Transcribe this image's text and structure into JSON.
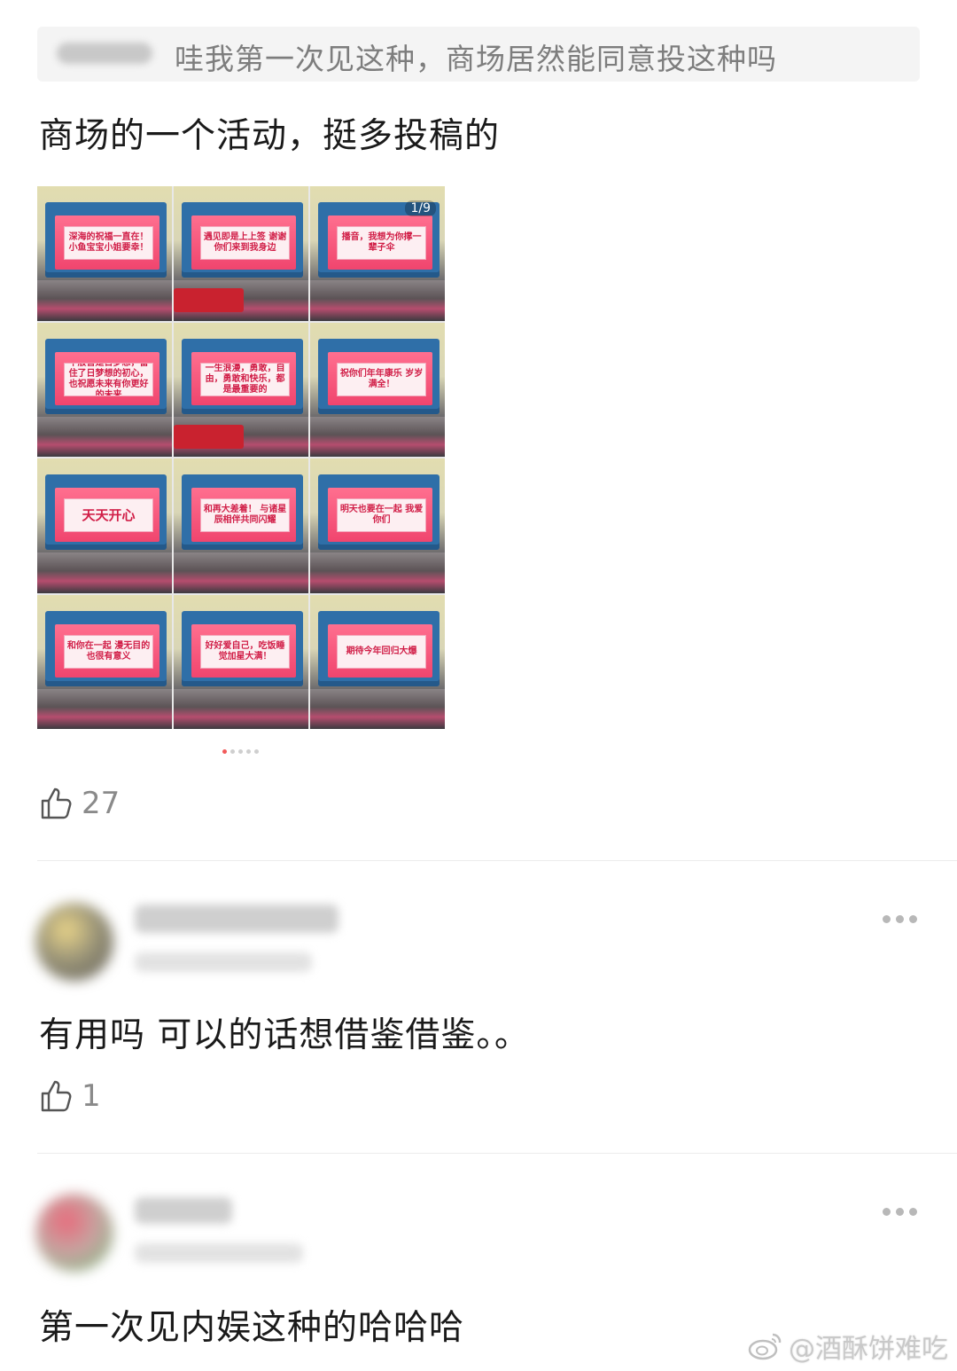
{
  "quote": {
    "text": "哇我第一次见这种，商场居然能同意投这种吗"
  },
  "post": {
    "text": "商场的一个活动，挺多投稿的",
    "gallery_counter": "1/9",
    "gallery_tiles": [
      {
        "text": "深海的祝福一直在！小鱼宝宝小姐要幸！",
        "big": false
      },
      {
        "text": "遇见即是上上签 谢谢你们来到我身边",
        "big": false
      },
      {
        "text": "播音，我想为你撑一辈子伞",
        "big": false
      },
      {
        "text": "千般皆是日梦想，留住了日梦想的初心，也祝愿未来有你更好的未来",
        "big": false
      },
      {
        "text": "一生浪漫，勇敢，自由，勇敢和快乐，都是最重要的",
        "big": false
      },
      {
        "text": "祝你们年年康乐 岁岁满全！",
        "big": false
      },
      {
        "text": "天天开心",
        "big": true
      },
      {
        "text": "和再大差着！ 与诸星辰相伴共同闪耀",
        "big": false
      },
      {
        "text": "明天也要在一起 我爱你们",
        "big": false
      },
      {
        "text": "和你在一起 漫无目的也很有意义",
        "big": false
      },
      {
        "text": "好好爱自己，吃饭睡觉加星大满！",
        "big": false
      },
      {
        "text": "期待今年回归大爆",
        "big": false
      }
    ],
    "likes": "27"
  },
  "comments": [
    {
      "text": "有用吗 可以的话想借鉴借鉴。。",
      "likes": "1"
    },
    {
      "text": "第一次见内娱这种的哈哈哈"
    }
  ],
  "watermark": {
    "text": "@酒酥饼难吃"
  },
  "colors": {
    "accent_dot": "#f25a5a",
    "screen_pink": "#f0456e",
    "building_blue": "#2f6fa8"
  }
}
